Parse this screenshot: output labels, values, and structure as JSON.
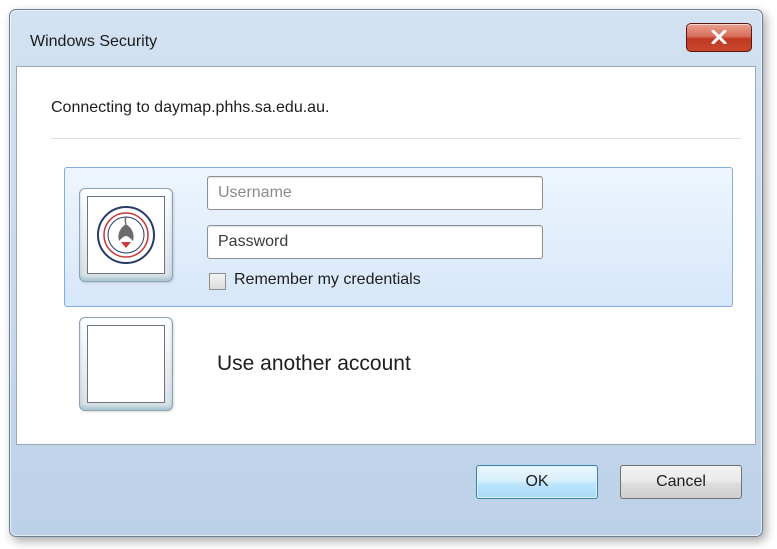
{
  "window": {
    "title": "Windows Security",
    "close_icon": "close-icon"
  },
  "message": {
    "connecting": "Connecting to daymap.phhs.sa.edu.au."
  },
  "credential_tile": {
    "logo_icon": "south-australia-emblem-icon",
    "username_placeholder": "Username",
    "username_value": "",
    "password_placeholder": "Password",
    "password_value": "",
    "remember_label": "Remember my credentials",
    "remember_checked": false
  },
  "other_account": {
    "label": "Use another account"
  },
  "buttons": {
    "ok": "OK",
    "cancel": "Cancel"
  },
  "colors": {
    "selected_tile": "#d6e7fa",
    "close_button": "#c8452c",
    "default_button": "#bee6fd"
  }
}
